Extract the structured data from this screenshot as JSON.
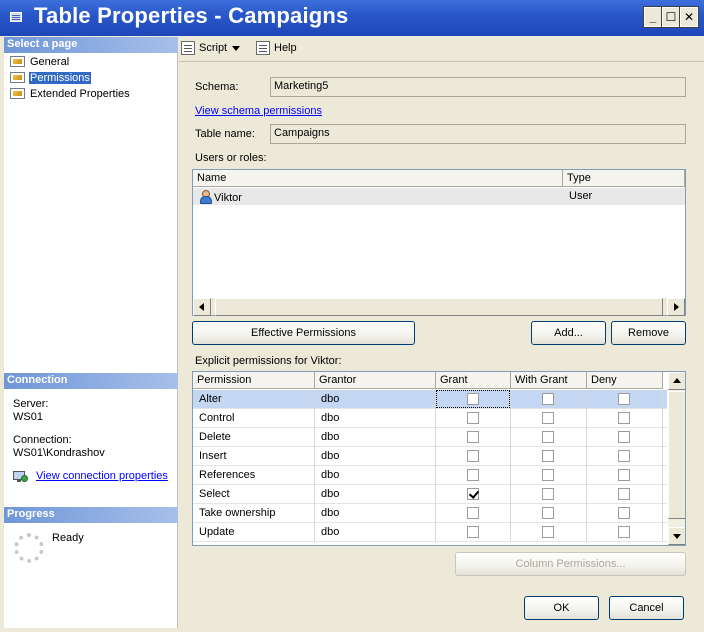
{
  "window": {
    "title": "Table Properties - Campaigns",
    "minimize_glyph": "_",
    "maximize_glyph": "☐",
    "close_glyph": "✕"
  },
  "left": {
    "select_page_header": "Select a page",
    "pages": [
      {
        "label": "General",
        "selected": false
      },
      {
        "label": "Permissions",
        "selected": true
      },
      {
        "label": "Extended Properties",
        "selected": false
      }
    ],
    "connection_header": "Connection",
    "server_label": "Server:",
    "server_value": "WS01",
    "connection_label": "Connection:",
    "connection_value": "WS01\\Kondrashov",
    "view_connection_link": "View connection properties",
    "progress_header": "Progress",
    "progress_status": "Ready"
  },
  "toolbar": {
    "script_label": "Script",
    "help_label": "Help"
  },
  "form": {
    "schema_label": "Schema:",
    "schema_value": "Marketing5",
    "view_schema_link": "View schema permissions",
    "table_name_label": "Table name:",
    "table_name_value": "Campaigns",
    "users_label": "Users or roles:"
  },
  "users_grid": {
    "columns": [
      "Name",
      "Type"
    ],
    "rows": [
      {
        "name": "Viktor",
        "type": "User"
      }
    ]
  },
  "buttons": {
    "effective_permissions": "Effective Permissions",
    "add": "Add...",
    "remove": "Remove",
    "column_permissions": "Column Permissions...",
    "ok": "OK",
    "cancel": "Cancel"
  },
  "permissions": {
    "label": "Explicit permissions for Viktor:",
    "columns": [
      "Permission",
      "Grantor",
      "Grant",
      "With Grant",
      "Deny"
    ],
    "rows": [
      {
        "permission": "Alter",
        "grantor": "dbo",
        "grant": false,
        "with_grant": false,
        "deny": false
      },
      {
        "permission": "Control",
        "grantor": "dbo",
        "grant": false,
        "with_grant": false,
        "deny": false
      },
      {
        "permission": "Delete",
        "grantor": "dbo",
        "grant": false,
        "with_grant": false,
        "deny": false
      },
      {
        "permission": "Insert",
        "grantor": "dbo",
        "grant": false,
        "with_grant": false,
        "deny": false
      },
      {
        "permission": "References",
        "grantor": "dbo",
        "grant": false,
        "with_grant": false,
        "deny": false
      },
      {
        "permission": "Select",
        "grantor": "dbo",
        "grant": true,
        "with_grant": false,
        "deny": false
      },
      {
        "permission": "Take ownership",
        "grantor": "dbo",
        "grant": false,
        "with_grant": false,
        "deny": false
      },
      {
        "permission": "Update",
        "grantor": "dbo",
        "grant": false,
        "with_grant": false,
        "deny": false
      }
    ]
  },
  "colors": {
    "titlebar": "#2A58C9",
    "selection": "#316AC5",
    "row_highlight": "#C4D7F2",
    "link": "#0000FF"
  }
}
